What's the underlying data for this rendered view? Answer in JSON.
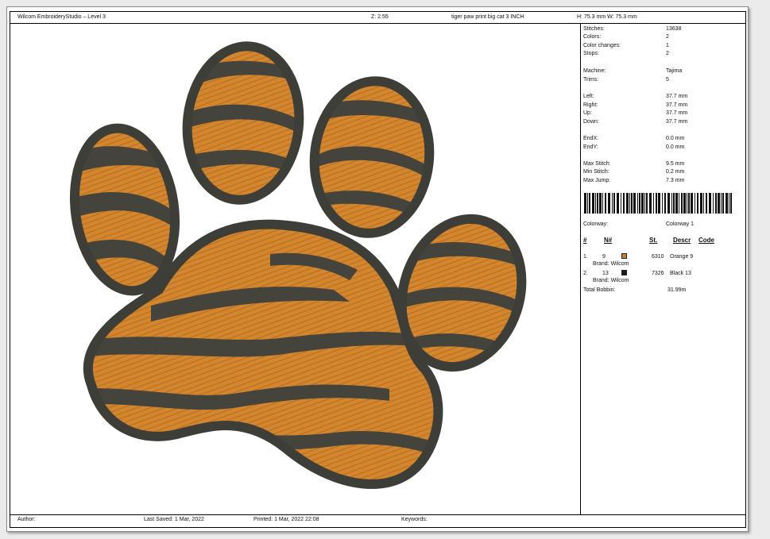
{
  "header": {
    "software": "Wilcom EmbroideryStudio – Level 3",
    "zoom": "Z: 2.55",
    "design_name": "tiger paw print big cat 3 INCH",
    "size": "H: 75.3 mm   W: 75.3 mm"
  },
  "info": [
    {
      "label": "Stitches:",
      "value": "13638"
    },
    {
      "label": "Colors:",
      "value": "2"
    },
    {
      "label": "Color changes:",
      "value": "1"
    },
    {
      "label": "Stops:",
      "value": "2"
    },
    {
      "label": "Machine:",
      "value": "Tajima"
    },
    {
      "label": "Trims:",
      "value": "5"
    },
    {
      "label": "Left:",
      "value": "37.7 mm"
    },
    {
      "label": "Right:",
      "value": "37.7 mm"
    },
    {
      "label": "Up:",
      "value": "37.7 mm"
    },
    {
      "label": "Down:",
      "value": "37.7 mm"
    },
    {
      "label": "EndX:",
      "value": "0.0 mm"
    },
    {
      "label": "EndY:",
      "value": "0.0 mm"
    },
    {
      "label": "Max Stitch:",
      "value": "9.5 mm"
    },
    {
      "label": "Min Stitch:",
      "value": "0.2 mm"
    },
    {
      "label": "Max Jump:",
      "value": "7.3 mm"
    }
  ],
  "colorway": {
    "label": "Colorway:",
    "value": "Colorway 1"
  },
  "table_headers": {
    "num": "#",
    "n": "N#",
    "st": "St.",
    "descr": "Descr",
    "code": "Code"
  },
  "colors": [
    {
      "index": "1.",
      "n": "9",
      "brand": "Brand: Wilcom",
      "stitches": "6310",
      "name": "Orange 9",
      "hex": "#d07a2a"
    },
    {
      "index": "2.",
      "n": "13",
      "brand": "Brand: Wilcom",
      "stitches": "7326",
      "name": "Black 13",
      "hex": "#1a1a1a"
    }
  ],
  "bobbin": {
    "label": "Total Bobbin:",
    "value": "31.99m"
  },
  "footer": {
    "author": "Author:",
    "last_saved": "Last Saved:  1 Mar, 2022",
    "printed": "Printed:  1 Mar, 2022 22:08",
    "keywords": "Keywords:"
  },
  "palette": {
    "orange": "#d4862e",
    "outline": "#3e3e38",
    "stripe": "#44443d"
  }
}
